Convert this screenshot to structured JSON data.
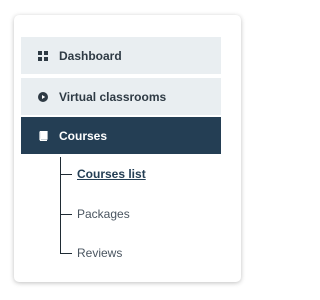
{
  "menu": {
    "items": [
      {
        "label": "Dashboard",
        "icon": "dashboard-grid-icon"
      },
      {
        "label": "Virtual classrooms",
        "icon": "play-circle-icon"
      },
      {
        "label": "Courses",
        "icon": "book-icon"
      }
    ],
    "sub_items": [
      {
        "label": "Courses list",
        "current": true
      },
      {
        "label": "Packages",
        "current": false
      },
      {
        "label": "Reviews",
        "current": false
      }
    ]
  },
  "colors": {
    "active_bg": "#243e54",
    "inactive_bg": "#e9eef1",
    "text_dark": "#2e3a44",
    "text_muted": "#4a5560"
  }
}
